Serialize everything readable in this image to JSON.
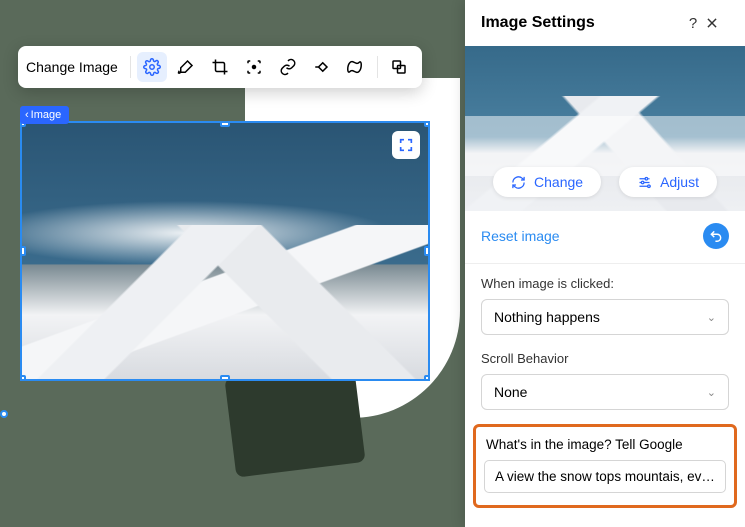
{
  "toolbar": {
    "change_label": "Change Image",
    "icons": {
      "settings": "gear-icon",
      "brush": "brush-icon",
      "crop": "crop-icon",
      "focus": "focus-icon",
      "link": "link-icon",
      "animation": "animation-icon",
      "mask": "mask-icon",
      "overlap": "overlap-icon"
    }
  },
  "breadcrumb": {
    "label": "Image"
  },
  "panel": {
    "title": "Image Settings",
    "change_label": "Change",
    "adjust_label": "Adjust",
    "reset_label": "Reset image",
    "click_section": {
      "label": "When image is clicked:",
      "value": "Nothing happens"
    },
    "scroll_section": {
      "label": "Scroll Behavior",
      "value": "None"
    },
    "alt_section": {
      "label": "What's in the image? Tell Google",
      "value": "A view the snow tops mountais, ever…"
    }
  }
}
